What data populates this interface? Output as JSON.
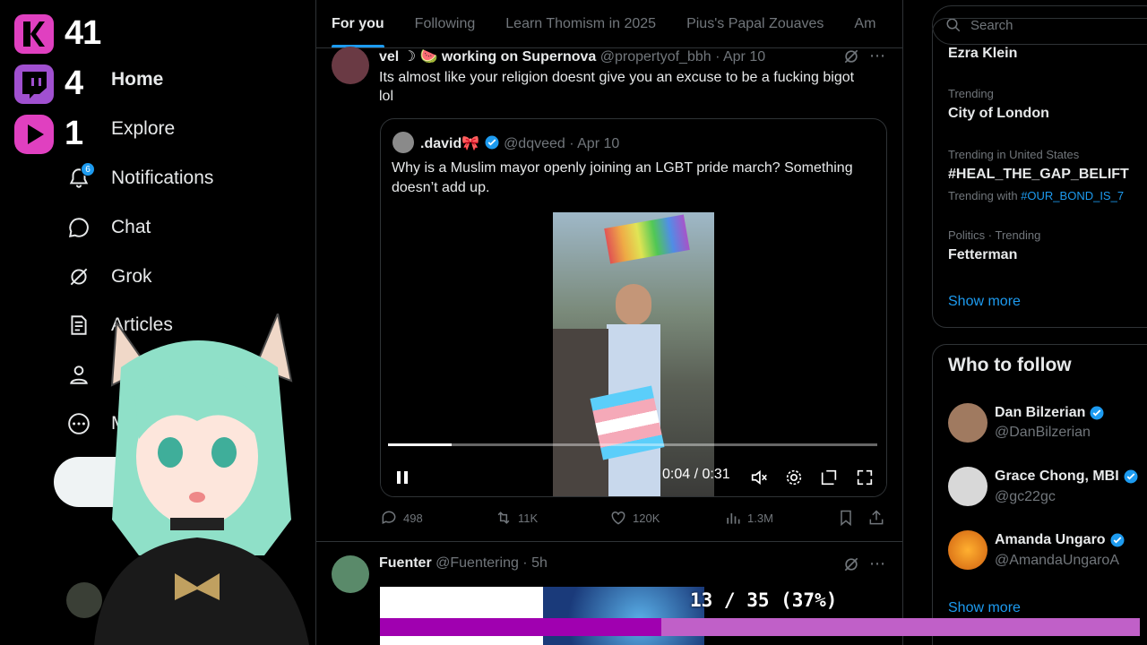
{
  "overlay": {
    "counters": [
      {
        "platform": "kick",
        "count": "41",
        "color": "#e040c0"
      },
      {
        "platform": "twitch",
        "count": "4",
        "color": "#a050d0"
      },
      {
        "platform": "youtube",
        "count": "1",
        "color": "#e040c0"
      }
    ],
    "progress": {
      "text": "13 / 35 (37%)",
      "current": 13,
      "total": 35,
      "fraction": 0.37
    }
  },
  "nav": {
    "items": [
      {
        "label": "Home",
        "icon": "home-icon",
        "bold": true
      },
      {
        "label": "Explore",
        "icon": "search-icon",
        "bold": false
      },
      {
        "label": "Notifications",
        "icon": "bell-icon",
        "bold": false,
        "badge": "6"
      },
      {
        "label": "Chat",
        "icon": "chat-bubble-icon",
        "bold": false
      },
      {
        "label": "Grok",
        "icon": "grok-icon",
        "bold": false
      },
      {
        "label": "Articles",
        "icon": "articles-icon",
        "bold": false
      },
      {
        "label": "",
        "icon": "profile-icon",
        "bold": false
      },
      {
        "label": "M",
        "icon": "more-icon",
        "bold": false
      }
    ]
  },
  "tabs": [
    {
      "label": "For you",
      "active": true
    },
    {
      "label": "Following",
      "active": false
    },
    {
      "label": "Learn Thomism in 2025",
      "active": false
    },
    {
      "label": "Pius's Papal Zouaves",
      "active": false
    },
    {
      "label": "Am",
      "active": false
    }
  ],
  "tweet1": {
    "name": "vel ☽ 🍉 working on Supernova",
    "handle": "@propertyof_bbh · Apr 10",
    "text_line1": "Its almost like your religion doesnt give you an excuse to be a fucking bigot",
    "text_line2": "lol",
    "quote": {
      "name": ".david🎀",
      "handle": "@dqveed · Apr 10",
      "text_line1": "Why is a Muslim mayor openly joining an LGBT pride march? Something",
      "text_line2": "doesn’t add up.",
      "video_time": "0:04 / 0:31",
      "video_progress": 0.13
    },
    "stats": {
      "replies": "498",
      "reposts": "11K",
      "likes": "120K",
      "views": "1.3M"
    }
  },
  "tweet2": {
    "name": "Fuenter",
    "handle": "@Fuentering · 5h"
  },
  "right": {
    "search_placeholder": "Search",
    "trends": [
      {
        "meta": "",
        "title": "Ezra Klein"
      },
      {
        "meta": "Trending",
        "title": "City of London"
      },
      {
        "meta": "Trending in United States",
        "title": "#HEAL_THE_GAP_BELIFT",
        "with_label": "Trending with",
        "with_tag": "#OUR_BOND_IS_7"
      },
      {
        "meta": "Politics · Trending",
        "title": "Fetterman"
      }
    ],
    "trends_show_more": "Show more",
    "who_to_follow_title": "Who to follow",
    "follow": [
      {
        "name": "Dan Bilzerian",
        "handle": "@DanBilzerian"
      },
      {
        "name": "Grace Chong, MBI",
        "handle": "@gc22gc"
      },
      {
        "name": "Amanda Ungaro",
        "handle": "@AmandaUngaroA"
      }
    ],
    "follow_show_more": "Show more"
  },
  "colors": {
    "accent": "#1d9bf0",
    "progress_bar": "#a000b0",
    "progress_track": "#c060c8"
  }
}
